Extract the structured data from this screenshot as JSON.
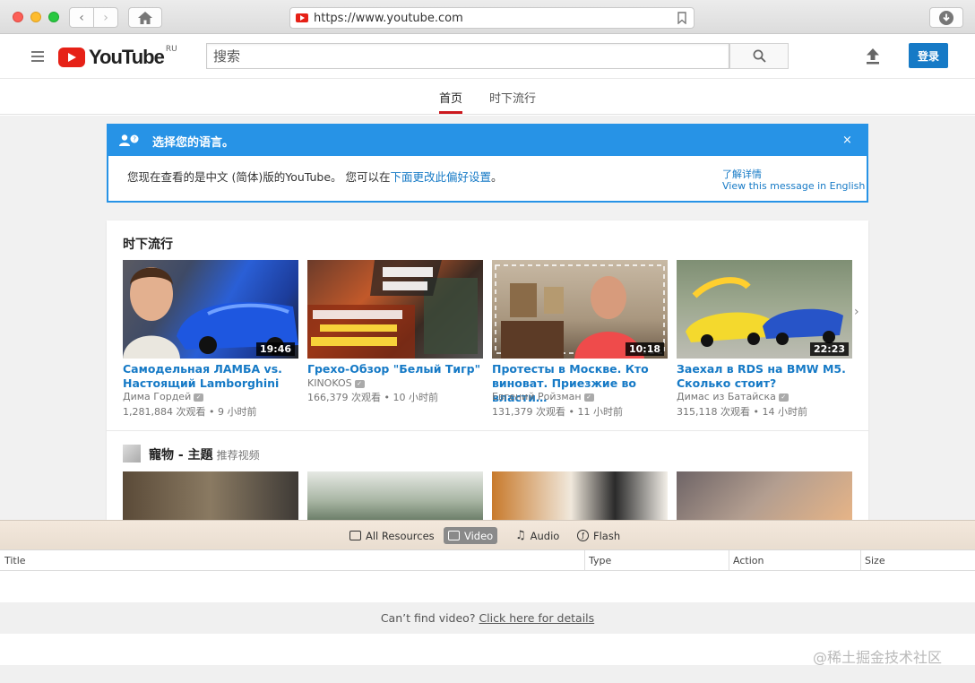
{
  "browser": {
    "url": "https://www.youtube.com"
  },
  "header": {
    "logo_text": "YouTube",
    "logo_region": "RU",
    "search_placeholder": "搜索",
    "login_label": "登录"
  },
  "tabs": [
    {
      "label": "首页",
      "active": true
    },
    {
      "label": "时下流行",
      "active": false
    }
  ],
  "language_banner": {
    "title": "选择您的语言。",
    "close": "×",
    "message_prefix": "您现在查看的是中文 (简体)版的YouTube。 您可以在",
    "message_link": "下面更改此偏好设置",
    "message_suffix": "。",
    "learn_more": "了解详情",
    "english_link": "View this message in English"
  },
  "trending": {
    "title": "时下流行",
    "videos": [
      {
        "title": "Самодельная ЛАМБА vs. Настоящий Lamborghini",
        "channel": "Дима Гордей",
        "views": "1,281,884 次观看",
        "age": "9 小时前",
        "duration": "19:46"
      },
      {
        "title": "Грехо-Обзор \"Белый Тигр\"",
        "channel": "KINOKOS",
        "views": "166,379 次观看",
        "age": "10 小时前",
        "duration": ""
      },
      {
        "title": "Протесты в Москве. Кто виноват. Приезжие во власти…",
        "channel": "Евгений Ройзман",
        "views": "131,379 次观看",
        "age": "11 小时前",
        "duration": "10:18"
      },
      {
        "title": "Заехал в RDS на BMW M5. Сколько стоит?",
        "channel": "Димас из Батайска",
        "views": "315,118 次观看",
        "age": "14 小时前",
        "duration": "22:23"
      }
    ]
  },
  "pets": {
    "title": "寵物 - 主題",
    "subtitle": "推荐视频"
  },
  "extension": {
    "buttons": [
      {
        "label": "All Resources",
        "active": false
      },
      {
        "label": "Video",
        "active": true
      },
      {
        "label": "Audio",
        "active": false
      },
      {
        "label": "Flash",
        "active": false
      }
    ],
    "columns": [
      "Title",
      "Type",
      "Action",
      "Size"
    ],
    "help_prefix": "Can’t find video? ",
    "help_link": "Click here for details"
  },
  "watermark": "@稀土掘金技术社区",
  "colors": {
    "youtube_red": "#e62117",
    "link_blue": "#167ac6",
    "banner_blue": "#2793e6"
  }
}
